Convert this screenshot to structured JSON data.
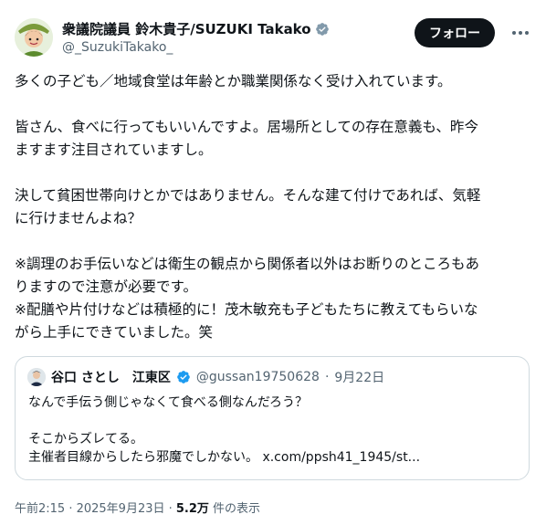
{
  "author": {
    "display_name": "衆議院議員 鈴木貴子/SUZUKI Takako",
    "handle": "@_SuzukiTakako_",
    "follow_label": "フォロー"
  },
  "tweet": {
    "paragraphs": [
      [
        "多くの子ども／地域食堂は年齢とか職業関係なく受け入れています。"
      ],
      [
        "皆さん、食べに行ってもいいんですよ。居場所としての存在意義も、昨今",
        "ますます注目されていますし。"
      ],
      [
        "決して貧困世帯向けとかではありません。そんな建て付けであれば、気軽",
        "に行けませんよね？"
      ],
      [
        "※調理のお手伝いなどは衛生の観点から関係者以外はお断りのところもあ",
        "りますので注意が必要です。",
        "※配膳や片付けなどは積極的に！茂木敏充も子どもたちに教えてもらいな",
        "がら上手にできていました。笑"
      ]
    ]
  },
  "quote": {
    "display_name": "谷口 さとし　江東区",
    "handle": "@gussan19750628",
    "date": "9月22日",
    "lines": [
      "なんで手伝う側じゃなくて食べる側なんだろう？",
      "",
      "そこからズレてる。",
      "主催者目線からしたら邪魔でしかない。 x.com/ppsh41_1945/st..."
    ]
  },
  "footer": {
    "timestamp": "午前2:15 · 2025年9月23日 · ",
    "views": "5.2万",
    "views_label": " 件の表示"
  }
}
